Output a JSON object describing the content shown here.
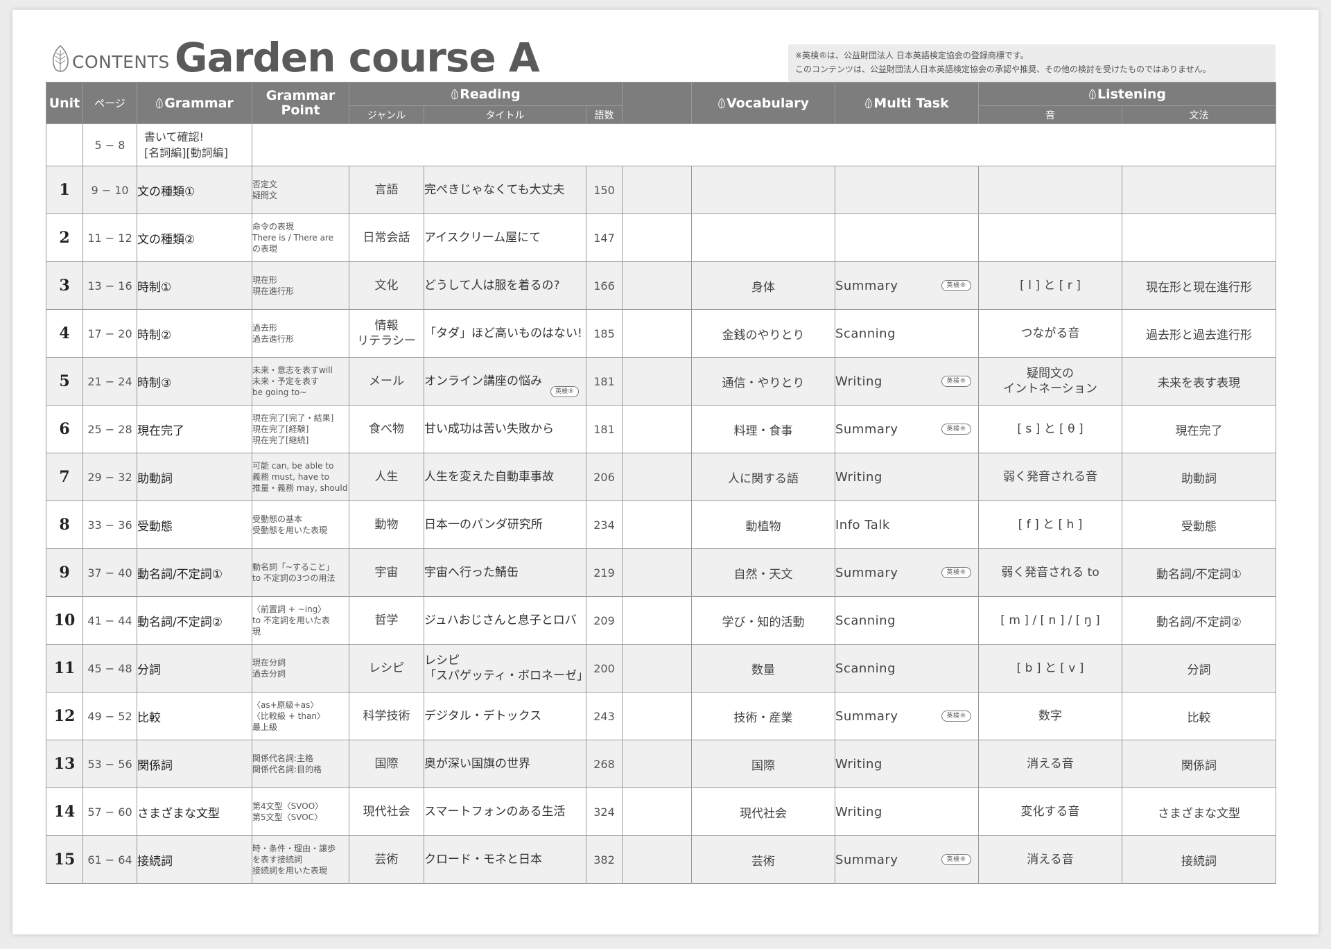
{
  "header": {
    "contents_label": "CONTENTS",
    "title": "Garden course A",
    "notice_line1": "※英検®は、公益財団法人 日本英語検定協会の登録商標です。",
    "notice_line2": "このコンテンツは、公益財団法人日本英語検定協会の承認や推奨、その他の検討を受けたものではありません。"
  },
  "columns": {
    "unit": "Unit",
    "page": "ページ",
    "grammar": "Grammar",
    "grammar_point": "Grammar Point",
    "reading": "Reading",
    "genre": "ジャンル",
    "title": "タイトル",
    "words": "語数",
    "vocabulary": "Vocabulary",
    "multi_task": "Multi Task",
    "listening": "Listening",
    "sound": "音",
    "listening_grammar": "文法"
  },
  "intro_row": {
    "pages": "5 − 8",
    "text": "書いて確認!\n[名詞編][動詞編]"
  },
  "badge_label": "英検®",
  "icons": {
    "leaf": "leaf-icon"
  },
  "colors": {
    "header_bg": "#7d7d7d",
    "stripe": "#f0f0f0",
    "title": "#5a5a5a"
  },
  "rows": [
    {
      "unit": "1",
      "pages": "9 − 10",
      "grammar": "文の種類①",
      "gp": "否定文\n疑問文",
      "genre": "言語",
      "title": "完ぺきじゃなくても大丈夫",
      "words": "150",
      "vocab": "",
      "mt": "",
      "mt_badge": false,
      "title_badge": false,
      "sound": "",
      "lgram": ""
    },
    {
      "unit": "2",
      "pages": "11 − 12",
      "grammar": "文の種類②",
      "gp": "命令の表現\nThere is / There are\nの表現",
      "genre": "日常会話",
      "title": "アイスクリーム屋にて",
      "words": "147",
      "vocab": "",
      "mt": "",
      "mt_badge": false,
      "title_badge": false,
      "sound": "",
      "lgram": ""
    },
    {
      "unit": "3",
      "pages": "13 − 16",
      "grammar": "時制①",
      "gp": "現在形\n現在進行形",
      "genre": "文化",
      "title": "どうして人は服を着るの?",
      "words": "166",
      "vocab": "身体",
      "mt": "Summary",
      "mt_badge": true,
      "title_badge": false,
      "sound": "[ l ] と [ r ]",
      "lgram": "現在形と現在進行形"
    },
    {
      "unit": "4",
      "pages": "17 − 20",
      "grammar": "時制②",
      "gp": "過去形\n過去進行形",
      "genre": "情報\nリテラシー",
      "title": "「タダ」ほど高いものはない!",
      "words": "185",
      "vocab": "金銭のやりとり",
      "mt": "Scanning",
      "mt_badge": false,
      "title_badge": false,
      "sound": "つながる音",
      "lgram": "過去形と過去進行形"
    },
    {
      "unit": "5",
      "pages": "21 − 24",
      "grammar": "時制③",
      "gp": "未来・意志を表すwill\n未来・予定を表す\nbe going to~",
      "genre": "メール",
      "title": "オンライン講座の悩み",
      "words": "181",
      "vocab": "通信・やりとり",
      "mt": "Writing",
      "mt_badge": true,
      "title_badge": true,
      "sound": "疑問文の\nイントネーション",
      "lgram": "未来を表す表現"
    },
    {
      "unit": "6",
      "pages": "25 − 28",
      "grammar": "現在完了",
      "gp": "現在完了[完了・結果]\n現在完了[経験]\n現在完了[継続]",
      "genre": "食べ物",
      "title": "甘い成功は苦い失敗から",
      "words": "181",
      "vocab": "料理・食事",
      "mt": "Summary",
      "mt_badge": true,
      "title_badge": false,
      "sound": "[ s ] と [ θ ]",
      "lgram": "現在完了"
    },
    {
      "unit": "7",
      "pages": "29 − 32",
      "grammar": "助動詞",
      "gp": "可能 can, be able to\n義務 must, have to\n推量・義務 may, should",
      "genre": "人生",
      "title": "人生を変えた自動車事故",
      "words": "206",
      "vocab": "人に関する語",
      "mt": "Writing",
      "mt_badge": false,
      "title_badge": false,
      "sound": "弱く発音される音",
      "lgram": "助動詞"
    },
    {
      "unit": "8",
      "pages": "33 − 36",
      "grammar": "受動態",
      "gp": "受動態の基本\n受動態を用いた表現",
      "genre": "動物",
      "title": "日本一のパンダ研究所",
      "words": "234",
      "vocab": "動植物",
      "mt": "Info Talk",
      "mt_badge": false,
      "title_badge": false,
      "sound": "[ f ] と [ h ]",
      "lgram": "受動態"
    },
    {
      "unit": "9",
      "pages": "37 − 40",
      "grammar": "動名詞/不定詞①",
      "gp": "動名詞「~すること」\nto 不定詞の3つの用法",
      "genre": "宇宙",
      "title": "宇宙へ行った鯖缶",
      "words": "219",
      "vocab": "自然・天文",
      "mt": "Summary",
      "mt_badge": true,
      "title_badge": false,
      "sound": "弱く発音される to",
      "lgram": "動名詞/不定詞①"
    },
    {
      "unit": "10",
      "pages": "41 − 44",
      "grammar": "動名詞/不定詞②",
      "gp": "〈前置詞 + ~ing〉\nto 不定詞を用いた表\n現",
      "genre": "哲学",
      "title": "ジュハおじさんと息子とロバ",
      "words": "209",
      "vocab": "学び・知的活動",
      "mt": "Scanning",
      "mt_badge": false,
      "title_badge": false,
      "sound": "[ m ] / [ n ] / [ ŋ ]",
      "lgram": "動名詞/不定詞②"
    },
    {
      "unit": "11",
      "pages": "45 − 48",
      "grammar": "分詞",
      "gp": "現在分詞\n過去分詞",
      "genre": "レシピ",
      "title": "レシピ\n「スパゲッティ・ボロネーゼ」",
      "words": "200",
      "vocab": "数量",
      "mt": "Scanning",
      "mt_badge": false,
      "title_badge": false,
      "sound": "[ b ] と [ v ]",
      "lgram": "分詞"
    },
    {
      "unit": "12",
      "pages": "49 − 52",
      "grammar": "比較",
      "gp": "〈as+原級+as〉\n〈比較級 + than〉\n最上級",
      "genre": "科学技術",
      "title": "デジタル・デトックス",
      "words": "243",
      "vocab": "技術・産業",
      "mt": "Summary",
      "mt_badge": true,
      "title_badge": false,
      "sound": "数字",
      "lgram": "比較"
    },
    {
      "unit": "13",
      "pages": "53 − 56",
      "grammar": "関係詞",
      "gp": "関係代名詞:主格\n関係代名詞:目的格",
      "genre": "国際",
      "title": "奥が深い国旗の世界",
      "words": "268",
      "vocab": "国際",
      "mt": "Writing",
      "mt_badge": false,
      "title_badge": false,
      "sound": "消える音",
      "lgram": "関係詞"
    },
    {
      "unit": "14",
      "pages": "57 − 60",
      "grammar": "さまざまな文型",
      "gp": "第4文型〈SVOO〉\n第5文型〈SVOC〉",
      "genre": "現代社会",
      "title": "スマートフォンのある生活",
      "words": "324",
      "vocab": "現代社会",
      "mt": "Writing",
      "mt_badge": false,
      "title_badge": false,
      "sound": "変化する音",
      "lgram": "さまざまな文型"
    },
    {
      "unit": "15",
      "pages": "61 − 64",
      "grammar": "接続詞",
      "gp": "時・条件・理由・譲歩\nを表す接続詞\n接続詞を用いた表現",
      "genre": "芸術",
      "title": "クロード・モネと日本",
      "words": "382",
      "vocab": "芸術",
      "mt": "Summary",
      "mt_badge": true,
      "title_badge": false,
      "sound": "消える音",
      "lgram": "接続詞"
    }
  ]
}
